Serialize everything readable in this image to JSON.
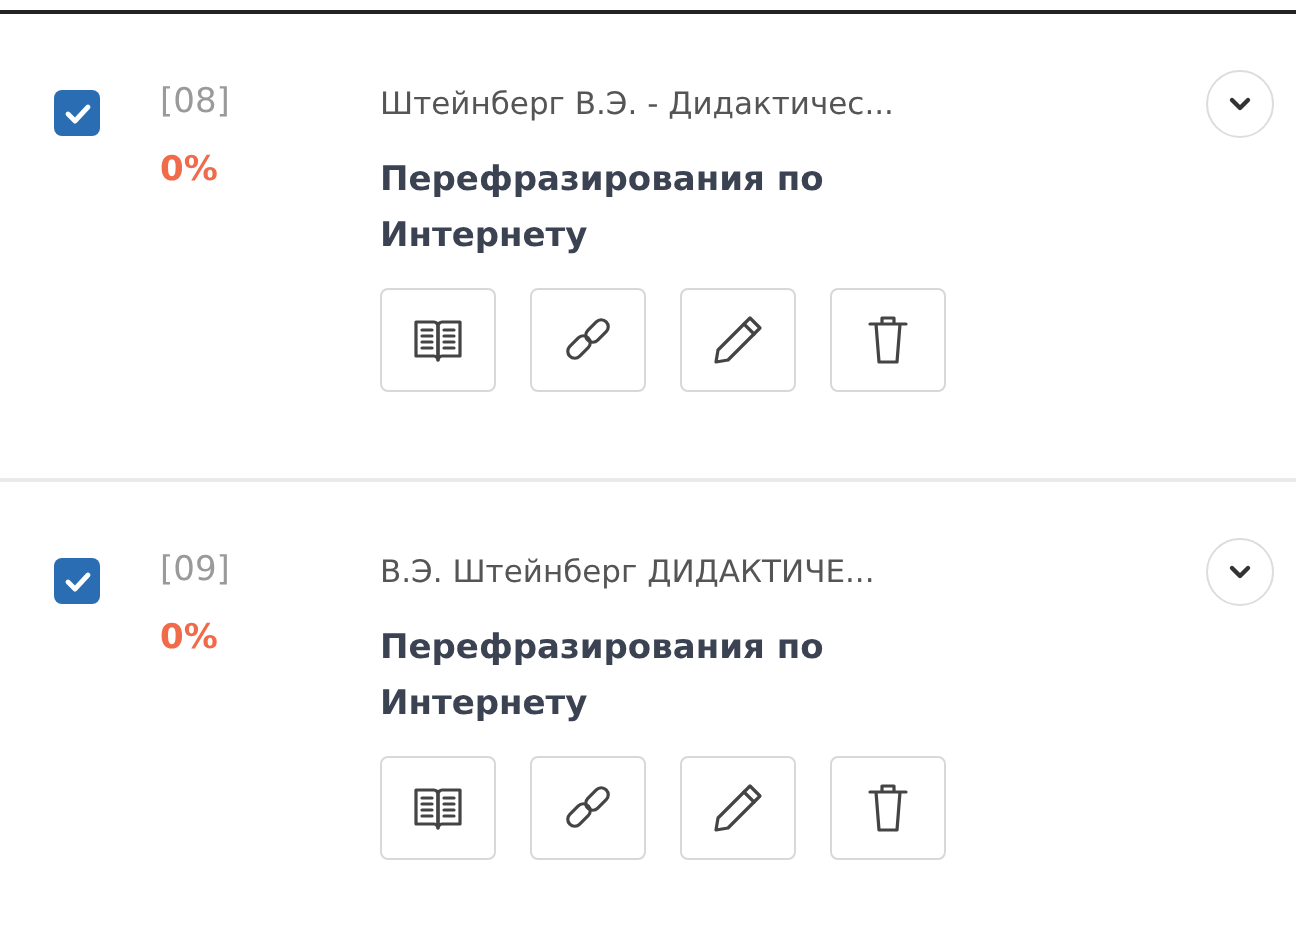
{
  "items": [
    {
      "checked": true,
      "number": "[08]",
      "percent": "0%",
      "source": "Штейнберг В.Э. - Дидактичес...",
      "type": "Перефразирования по Интернету",
      "actions": [
        {
          "kind": "book"
        },
        {
          "kind": "link"
        },
        {
          "kind": "edit"
        },
        {
          "kind": "delete"
        }
      ]
    },
    {
      "checked": true,
      "number": "[09]",
      "percent": "0%",
      "source": "В.Э. Штейнберг ДИДАКТИЧЕ...",
      "type": "Перефразирования по Интернету",
      "actions": [
        {
          "kind": "book"
        },
        {
          "kind": "link"
        },
        {
          "kind": "edit"
        },
        {
          "kind": "delete"
        }
      ]
    }
  ]
}
